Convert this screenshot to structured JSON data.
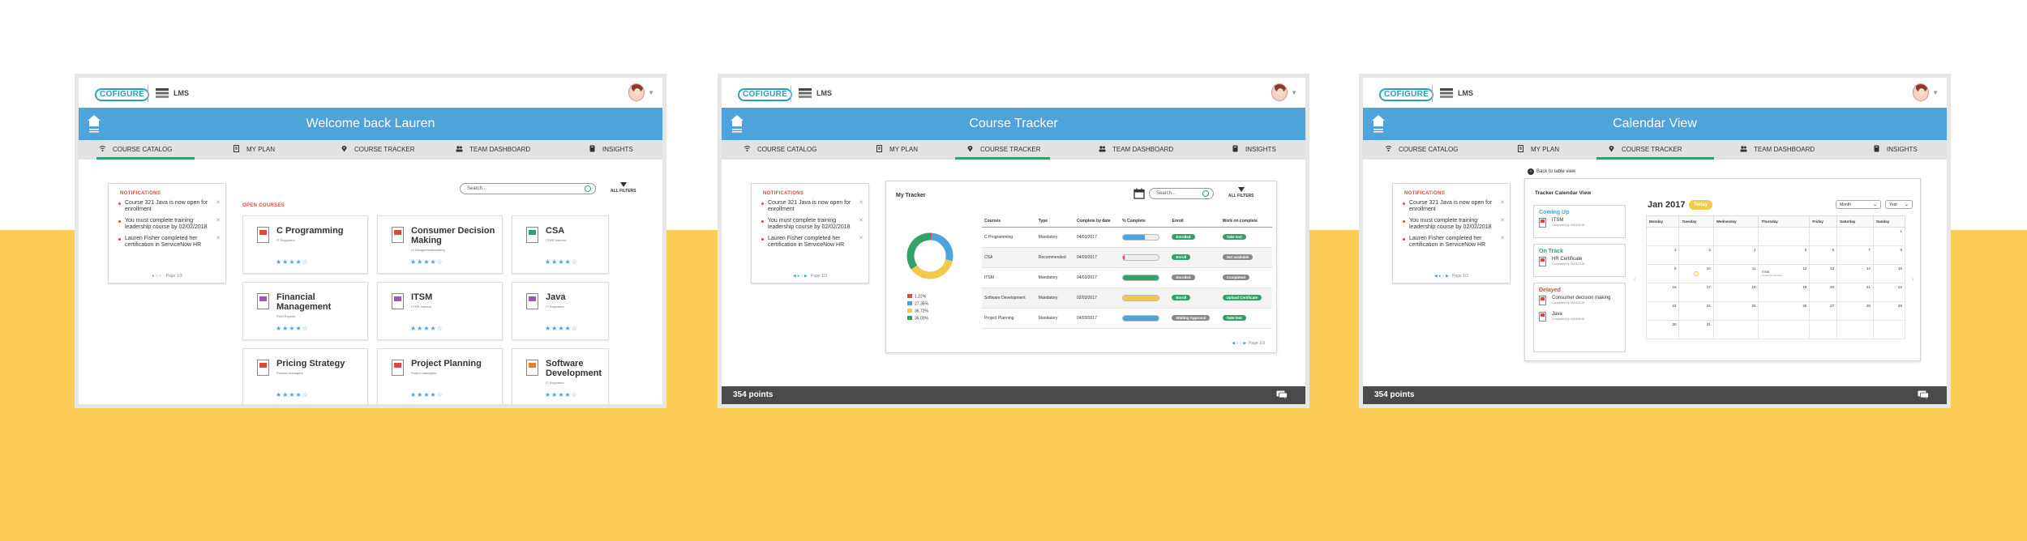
{
  "common": {
    "logo": "COFIGURE",
    "app_label": "LMS",
    "nav": [
      "COURSE CATALOG",
      "MY PLAN",
      "COURSE TRACKER",
      "TEAM DASHBOARD",
      "INSIGHTS"
    ],
    "points": "354 points"
  },
  "panel1": {
    "header": "Welcome back Lauren",
    "notifications": {
      "title": "NOTIFICATIONS",
      "items": [
        "Course 321 Java is now open for enrollment",
        "You must complete training leadership course by 02/02/2018",
        "Lauren Fisher completed her certification in ServiceNow HR"
      ],
      "pager": "Page 1/3"
    },
    "search_placeholder": "Search...",
    "filters": "ALL FILTERS",
    "open_label": "OPEN COURSES",
    "courses": [
      {
        "title": "C Programming",
        "sub": "IT Engineers"
      },
      {
        "title": "Consumer Decision Making",
        "sub": "Ui Designers/Marketing"
      },
      {
        "title": "CSA",
        "sub": "IT/HR Interest"
      },
      {
        "title": "Financial Management",
        "sub": "Field Experts"
      },
      {
        "title": "ITSM",
        "sub": "IT/HR Interest"
      },
      {
        "title": "Java",
        "sub": "IT Engineers"
      },
      {
        "title": "Pricing Strategy",
        "sub": "Product managers"
      },
      {
        "title": "Project Planning",
        "sub": "Project managers"
      },
      {
        "title": "Software Development",
        "sub": "IT Engineers"
      }
    ],
    "rating": "★★★★☆"
  },
  "panel2": {
    "header": "Course Tracker",
    "notifications": {
      "title": "NOTIFICATIONS",
      "items": [
        "Course 321 Java is now open for enrollment",
        "You must complete training leadership course by 02/02/2018",
        "Lauren Fisher completed her certification in ServiceNow HR"
      ],
      "pager": "Page 1/3"
    },
    "tracker_title": "My Tracker",
    "search_placeholder": "Search...",
    "filters": "ALL FILTERS",
    "legend": [
      "1.22%",
      "27.35%",
      "36.72%",
      "35.00%"
    ],
    "colors": [
      "#e0473c",
      "#4da3da",
      "#f2c94c",
      "#34a06a"
    ],
    "columns": [
      "Courses",
      "Type",
      "Complete by date",
      "% Complete",
      "Enroll",
      "Work on complete"
    ],
    "rows": [
      {
        "course": "C Programming",
        "type": "Mandatory",
        "date": "04/03/2017",
        "pct": 0.6,
        "color": "#4da3da",
        "enroll": "Enrolled",
        "enroll_color": "#34a06a",
        "work": "Take test",
        "work_color": "#34a06a"
      },
      {
        "course": "CSA",
        "type": "Recommended",
        "date": "04/03/2017",
        "pct": 0.05,
        "color": "#e0473c",
        "enroll": "Enroll",
        "enroll_color": "#34a06a",
        "work": "Not available",
        "work_color": "#888888"
      },
      {
        "course": "ITSM",
        "type": "Mandatory",
        "date": "04/03/2017",
        "pct": 1.0,
        "color": "#34a06a",
        "enroll": "Enrolled",
        "enroll_color": "#888888",
        "work": "Completed",
        "work_color": "#888888"
      },
      {
        "course": "Software Development",
        "type": "Mandatory",
        "date": "02/03/2017",
        "pct": 1.0,
        "color": "#f2c94c",
        "enroll": "Enroll",
        "enroll_color": "#34a06a",
        "work": "Upload Certificate",
        "work_color": "#34a06a"
      },
      {
        "course": "Project Planning",
        "type": "Mandatory",
        "date": "04/03/2017",
        "pct": 1.0,
        "color": "#4da3da",
        "enroll": "Waiting Approval",
        "enroll_color": "#888888",
        "work": "Take test",
        "work_color": "#34a06a"
      }
    ],
    "donut": [
      0.0122,
      0.2735,
      0.3672,
      0.35
    ],
    "pager": "Page 1/3"
  },
  "panel3": {
    "header": "Calendar View",
    "notifications": {
      "title": "NOTIFICATIONS",
      "items": [
        "Course 321 Java is now open for enrollment",
        "You must complete training leadership course by 02/02/2018",
        "Lauren Fisher completed her certification in ServiceNow HR"
      ],
      "pager": "Page 1/3"
    },
    "back_link": "Back to table view",
    "cal_title": "Tracker Calendar View",
    "coming_up": {
      "title": "Coming Up",
      "color": "#4da3da",
      "items": [
        {
          "name": "ITSM",
          "sub": "Completed by 03/04/2018"
        }
      ]
    },
    "on_track": {
      "title": "On Track",
      "color": "#34a06a",
      "items": [
        {
          "name": "HR Certificate",
          "sub": "Completed by 03/04/2018"
        }
      ]
    },
    "delayed": {
      "title": "Delayed",
      "color": "#e0473c",
      "items": [
        {
          "name": "Consumer decision making",
          "sub": "Completed by 03/04/2018"
        },
        {
          "name": "Java",
          "sub": "Completed by 03/04/2018"
        }
      ]
    },
    "month": "Jan 2017",
    "today": "Today",
    "view_select": "Month",
    "year_select": "Year",
    "weekdays": [
      "Monday",
      "Tuesday",
      "Wednesday",
      "Thursday",
      "Friday",
      "Saturday",
      "Sunday"
    ],
    "weeks": [
      [
        "",
        "",
        "",
        "",
        "",
        "",
        "1"
      ],
      [
        "2",
        "3",
        "4",
        "5",
        "6",
        "7",
        "8"
      ],
      [
        "9",
        "10",
        "11",
        "12",
        "13",
        "14",
        "15"
      ],
      [
        "16",
        "17",
        "18",
        "19",
        "20",
        "21",
        "22"
      ],
      [
        "23",
        "24",
        "25",
        "26",
        "27",
        "28",
        "29"
      ],
      [
        "30",
        "31",
        "",
        "",
        "",
        "",
        ""
      ]
    ],
    "event": {
      "name": "ITSM",
      "sub": "Consumer decision"
    }
  }
}
